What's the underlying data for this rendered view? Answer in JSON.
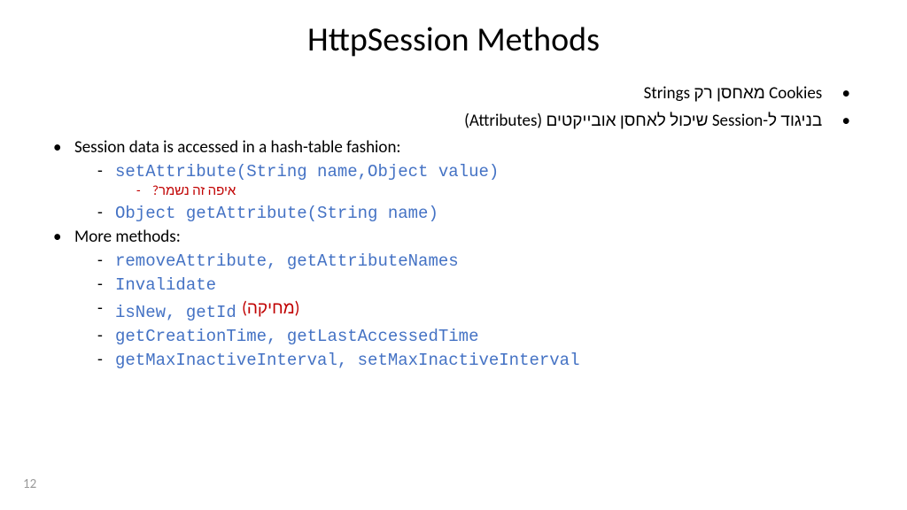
{
  "title": "HttpSession Methods",
  "rtl_bullets": [
    "Cookies  מאחסן רק Strings",
    "בניגוד ל-Session שיכול לאחסן אובייקטים (Attributes)"
  ],
  "ltr": {
    "item1": "Session data is accessed in a hash-table fashion:",
    "sub1a": "setAttribute(String name,Object value)",
    "sub1a_note": "איפה זה נשמר?",
    "sub1b": "Object getAttribute(String name)",
    "item2": "More methods:",
    "sub2a": "removeAttribute, getAttributeNames",
    "sub2b": "Invalidate",
    "sub2c": "isNew, getId",
    "sub2c_anno": "(מחיקה)",
    "sub2d": "getCreationTime, getLastAccessedTime",
    "sub2e": "getMaxInactiveInterval, setMaxInactiveInterval"
  },
  "page_number": "12"
}
